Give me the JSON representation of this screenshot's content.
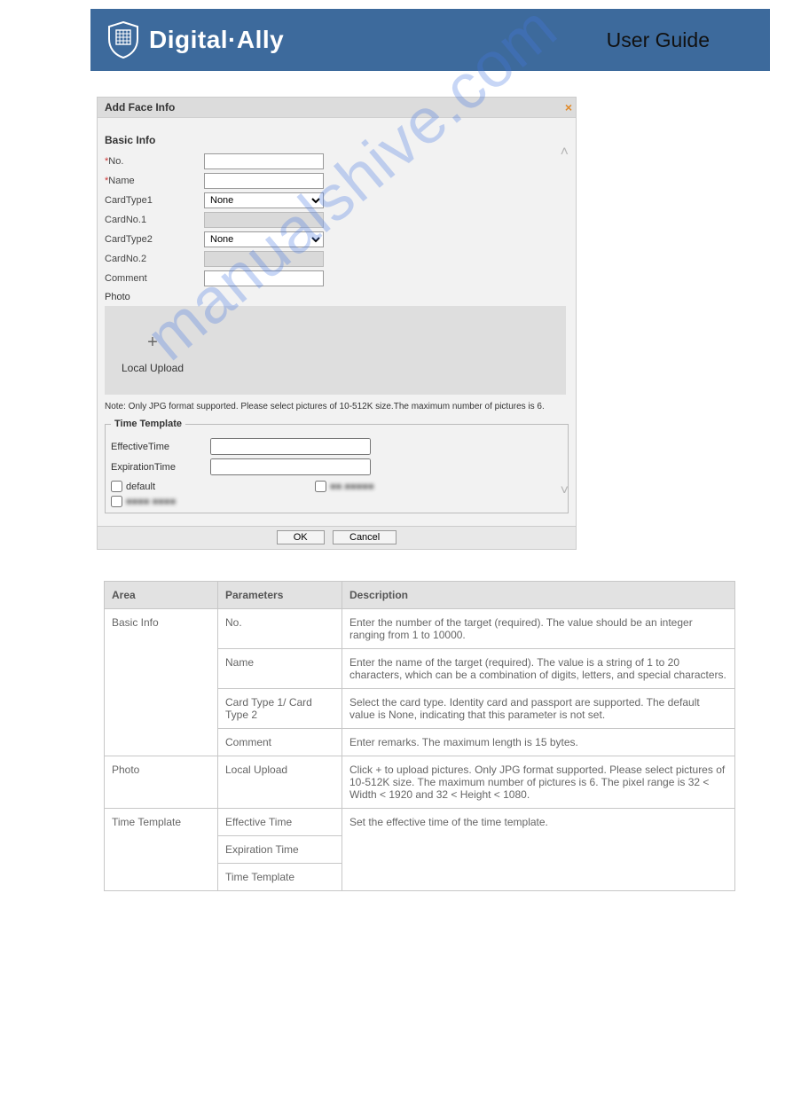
{
  "header": {
    "brand_name": "Digital·Ally",
    "user_guide": "User Guide"
  },
  "dialog": {
    "title": "Add Face Info",
    "close_glyph": "×",
    "basic_info_heading": "Basic Info",
    "fields": {
      "no_label": "No.",
      "name_label": "Name",
      "cardtype1_label": "CardType1",
      "cardtype1_value": "None",
      "cardno1_label": "CardNo.1",
      "cardtype2_label": "CardType2",
      "cardtype2_value": "None",
      "cardno2_label": "CardNo.2",
      "comment_label": "Comment",
      "photo_label": "Photo"
    },
    "upload": {
      "plus": "+",
      "local_upload_label": "Local Upload"
    },
    "note": "Note: Only JPG format supported. Please select pictures of 10-512K size.The maximum number of pictures is 6.",
    "time_template": {
      "legend": "Time Template",
      "effective_label": "EffectiveTime",
      "expiration_label": "ExpirationTime",
      "default_label": "default",
      "obscured1": "■■.■■■■■",
      "obscured2": "■■■■ ■■■■"
    },
    "buttons": {
      "ok": "OK",
      "cancel": "Cancel"
    }
  },
  "watermark": "manualshive.com",
  "table": {
    "headers": {
      "col1": "Area",
      "col2": "Parameters",
      "col3": "Description"
    },
    "rows": [
      {
        "area": "Basic Info",
        "param": "No.",
        "desc": "Enter the number of the target (required). The value should be an integer ranging from 1 to 10000."
      },
      {
        "area": "",
        "param": "Name",
        "desc": "Enter the name of the target (required). The value is a string of 1 to 20 characters, which can be a combination of digits, letters, and special characters."
      },
      {
        "area": "",
        "param": "Card Type 1/ Card Type 2",
        "desc": "Select the card type. Identity card and passport are supported. The default value is None, indicating that this parameter is not set."
      },
      {
        "area": "",
        "param": "Comment",
        "desc": "Enter remarks. The maximum length is 15 bytes."
      },
      {
        "area": "Photo",
        "param": "Local Upload",
        "desc": "Click + to upload pictures. Only JPG format supported. Please select pictures of 10-512K size. The maximum number of pictures is 6. The pixel range is 32 < Width < 1920 and 32 < Height < 1080."
      },
      {
        "area": "Time Template",
        "param": "Effective Time",
        "desc": "Set the effective time of the time template."
      },
      {
        "area": "",
        "param": "Expiration Time",
        "desc": ""
      },
      {
        "area": "",
        "param": "Time Template",
        "desc": ""
      }
    ]
  }
}
